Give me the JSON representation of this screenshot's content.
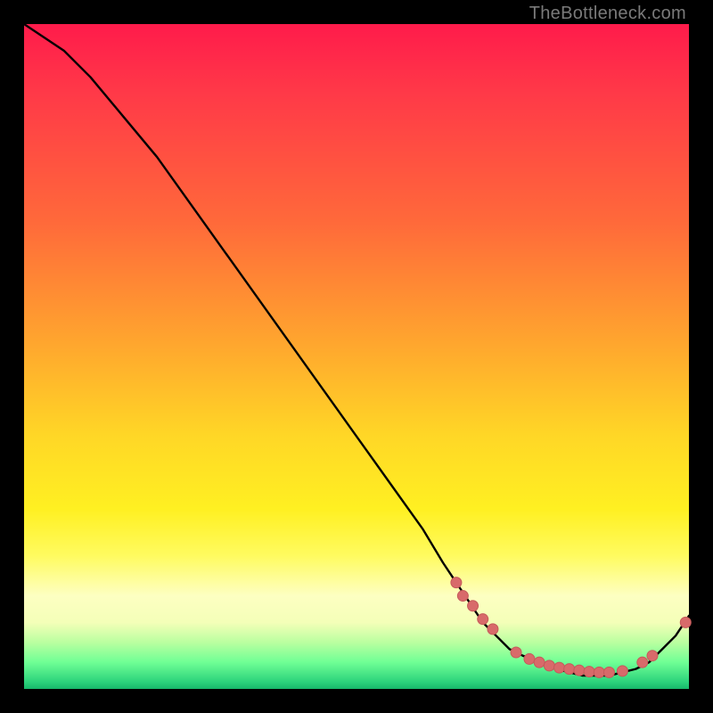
{
  "watermark": "TheBottleneck.com",
  "colors": {
    "curve": "#000000",
    "marker_fill": "#d86a6a",
    "marker_stroke": "#c55a5a",
    "frame": "#000000"
  },
  "chart_data": {
    "type": "line",
    "title": "",
    "xlabel": "",
    "ylabel": "",
    "xlim": [
      0,
      100
    ],
    "ylim": [
      0,
      100
    ],
    "series": [
      {
        "name": "bottleneck-curve",
        "x": [
          0,
          6,
          10,
          15,
          20,
          25,
          30,
          35,
          40,
          45,
          50,
          55,
          60,
          63,
          65,
          67,
          69,
          71,
          73,
          75,
          78,
          80,
          82,
          84,
          86,
          88,
          90,
          92,
          94,
          96,
          98,
          100
        ],
        "values": [
          100,
          96,
          92,
          86,
          80,
          73,
          66,
          59,
          52,
          45,
          38,
          31,
          24,
          19,
          16,
          13,
          10,
          8,
          6,
          5,
          4,
          3,
          2.5,
          2,
          2,
          2,
          2.5,
          3,
          4,
          6,
          8,
          11
        ]
      }
    ],
    "markers": {
      "name": "highlight-points",
      "x": [
        65,
        66,
        67.5,
        69,
        70.5,
        74,
        76,
        77.5,
        79,
        80.5,
        82,
        83.5,
        85,
        86.5,
        88,
        90,
        93,
        94.5,
        99.5
      ],
      "values": [
        16,
        14,
        12.5,
        10.5,
        9,
        5.5,
        4.5,
        4,
        3.5,
        3.2,
        3,
        2.8,
        2.6,
        2.5,
        2.5,
        2.7,
        4,
        5,
        10
      ]
    }
  }
}
